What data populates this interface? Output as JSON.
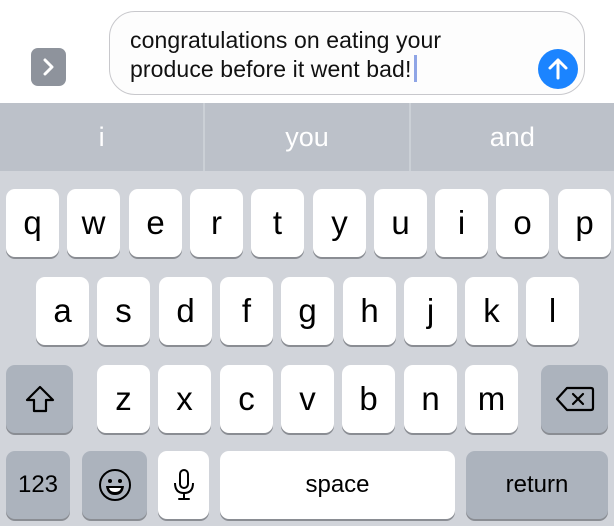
{
  "compose": {
    "message_lines": [
      "congratulations on eating your",
      "produce before it went bad!"
    ],
    "expand_icon": "chevron-right-icon",
    "send_icon": "arrow-up-icon",
    "colors": {
      "send": "#1B84FF",
      "expand": "#8E939C",
      "caret": "#8FA5E6"
    }
  },
  "suggestions": [
    "i",
    "you",
    "and"
  ],
  "keyboard": {
    "row1": [
      "q",
      "w",
      "e",
      "r",
      "t",
      "y",
      "u",
      "i",
      "o",
      "p"
    ],
    "row2": [
      "a",
      "s",
      "d",
      "f",
      "g",
      "h",
      "j",
      "k",
      "l"
    ],
    "row3": [
      "z",
      "x",
      "c",
      "v",
      "b",
      "n",
      "m"
    ],
    "shift_icon": "shift-arrow-icon",
    "backspace_icon": "backspace-icon",
    "numbers_label": "123",
    "emoji_icon": "emoji-smile-icon",
    "mic_icon": "microphone-icon",
    "space_label": "space",
    "return_label": "return"
  }
}
